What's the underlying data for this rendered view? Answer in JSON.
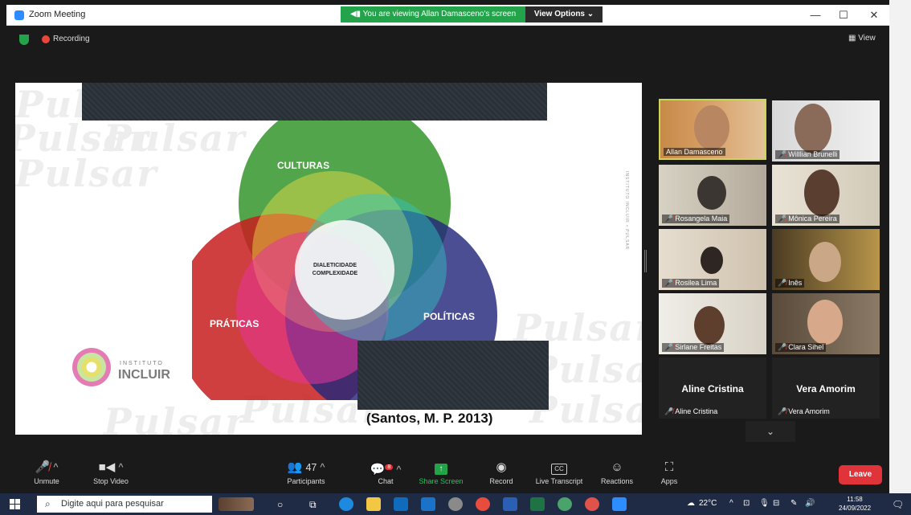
{
  "window": {
    "title": "Zoom Meeting"
  },
  "share_banner": {
    "text": "You are viewing Allan Damasceno's screen",
    "view_options": "View Options"
  },
  "window_controls": {
    "minimize": "—",
    "maximize": "☐",
    "close": "✕"
  },
  "status": {
    "recording": "Recording",
    "view": "View"
  },
  "slide": {
    "watermark": "Pulsar",
    "circles": {
      "culturas": "CULTURAS",
      "praticas": "PRÁTICAS",
      "politicas": "POLÍTICAS"
    },
    "center": [
      "DIALETICIDADE",
      "COMPLEXIDADE"
    ],
    "citation": "(Santos, M. P. 2013)",
    "logo": {
      "line1": "INSTITUTO",
      "line2": "INCLUIR"
    },
    "vertical_text": "INSTITUTO INCLUIR • PULSAR"
  },
  "participants": [
    {
      "name": "Allan Damasceno",
      "muted": false
    },
    {
      "name": "Willlian Brunelli",
      "muted": true
    },
    {
      "name": "Rosangela Maia",
      "muted": true
    },
    {
      "name": "Mônica Pereira",
      "muted": true
    },
    {
      "name": "Rosilea Lima",
      "muted": true
    },
    {
      "name": "Inês",
      "muted": true
    },
    {
      "name": "Sirlane Freitas",
      "muted": true
    },
    {
      "name": "Clara Sihel",
      "muted": true
    },
    {
      "name": "Aline Cristina",
      "muted": true
    },
    {
      "name": "Vera Amorim",
      "muted": true
    }
  ],
  "big_names": {
    "aline": "Aline Cristina",
    "vera": "Vera Amorim"
  },
  "toolbar": {
    "unmute": "Unmute",
    "stop_video": "Stop Video",
    "participants": "Participants",
    "participants_count": "47",
    "chat": "Chat",
    "chat_badge": "8",
    "share_screen": "Share Screen",
    "record": "Record",
    "live_transcript": "Live Transcript",
    "reactions": "Reactions",
    "apps": "Apps",
    "leave": "Leave"
  },
  "taskbar": {
    "search_placeholder": "Digite aqui para pesquisar",
    "temperature": "22°C",
    "time": "11:58",
    "date": "24/09/2022"
  },
  "colors": {
    "accent": "#2d8cff",
    "share_green": "#23a34a",
    "leave_red": "#e0343a"
  }
}
